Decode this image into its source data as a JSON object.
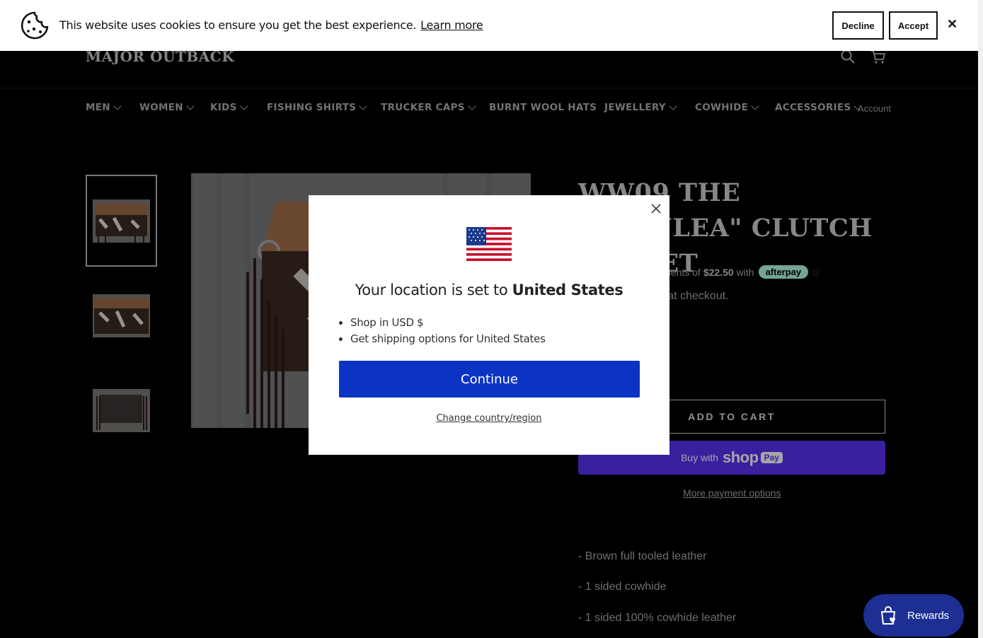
{
  "cookie": {
    "message": "This website uses cookies to ensure you get the best experience.",
    "learn_more": "Learn more",
    "decline": "Decline",
    "accept": "Accept",
    "close": "✕"
  },
  "header": {
    "brand": "MAJOR OUTBACK"
  },
  "nav": {
    "items": [
      {
        "label": "MEN"
      },
      {
        "label": "WOMEN"
      },
      {
        "label": "KIDS"
      },
      {
        "label": "FISHING SHIRTS"
      },
      {
        "label": "TRUCKER CAPS"
      },
      {
        "label": "BURNT WOOL HATS"
      },
      {
        "label": "JEWELLERY"
      },
      {
        "label": "COWHIDE"
      },
      {
        "label": "ACCESSORIES"
      }
    ],
    "account": "Account"
  },
  "product": {
    "title": "WW09 THE \"FERNLEA\" CLUTCH WALLET",
    "afterpay_prefix": "nents of",
    "afterpay_amount": "$22.50",
    "afterpay_with": "with",
    "afterpay_brand": "afterpay",
    "checkout_note": "d at checkout.",
    "add_to_cart": "ADD TO CART",
    "buy_with": "Buy with",
    "shop_pay_logo": "shop",
    "shop_pay_pay": "Pay",
    "more_payment": "More payment options",
    "description": [
      "- Brown full tooled leather",
      "- 1 sided cowhide",
      "- 1 sided 100% cowhide leather"
    ]
  },
  "modal": {
    "title_prefix": "Your location is set to",
    "title_country": "United States",
    "bullets": [
      "Shop in USD $",
      "Get shipping options for United States"
    ],
    "continue": "Continue",
    "change": "Change country/region"
  },
  "rewards": {
    "label": "Rewards"
  },
  "colors": {
    "continue_button": "#0c34c4",
    "shop_pay": "#5a31f4",
    "rewards": "#1d2f93",
    "afterpay_badge": "#b2fce4"
  }
}
